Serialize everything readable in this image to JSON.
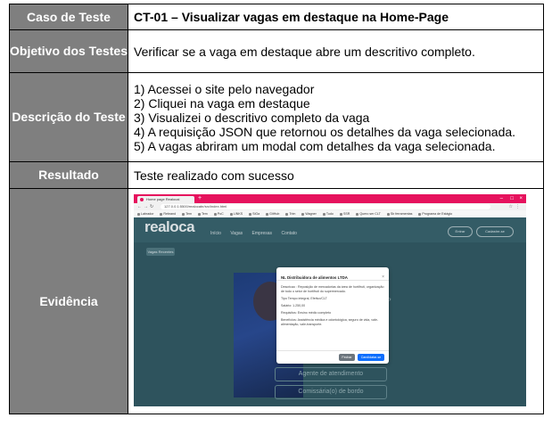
{
  "rows": {
    "caso": {
      "label": "Caso de Teste",
      "value": "CT-01 – Visualizar vagas em destaque na Home-Page"
    },
    "objetivo": {
      "label": "Objetivo dos Testes",
      "value": "Verificar se a vaga em destaque abre um descritivo completo."
    },
    "descricao": {
      "label": "Descrição do Teste",
      "steps": [
        "1) Acessei o site pelo navegador",
        "2) Cliquei na vaga em destaque",
        "3) Visualizei o descritivo completo da vaga",
        "4) A requisição JSON que retornou os detalhes da vaga selecionada.",
        "5) A vagas abriram um modal com detalhes da vaga selecionada."
      ]
    },
    "resultado": {
      "label": "Resultado",
      "value": "Teste realizado com sucesso"
    },
    "evidencia": {
      "label": "Evidência"
    }
  },
  "screenshot": {
    "browser": {
      "tab_title": "Home page Realocai",
      "url": "127.0.0.1:5500/realocabr/src/index.html",
      "bookmarks": [
        "Labrador",
        "Rebrand",
        "Tem",
        "Tem",
        "PoC",
        "LINKS",
        "SiGa",
        "GitHub",
        "Trim",
        "Wagner",
        "Tudo",
        "SSR",
        "Quero ser CLT",
        "Sb ferramentas",
        "Programa de Estágio"
      ],
      "colors": {
        "tab_bar": "#e6125d",
        "page_bg": "#2e535d"
      }
    },
    "site": {
      "logo": "realoca",
      "nav": [
        "Início",
        "Vagas",
        "Empresas",
        "Contato"
      ],
      "login_label": "Entrar",
      "signup_label": "Cadastre-se",
      "sub_button": "Vagas Recentes",
      "cards": [
        "Agente de atendimento",
        "Comissária(o) de bordo"
      ]
    },
    "modal": {
      "title": "NL Distribuidora de alimentos LTDA",
      "description": "Descricao : Reposição de mercadorias da área de hortifruti, organização de todo o setor de hortifruti do supermercado.",
      "tipo": "Tipo Tempo integral, Efetivo/CLT",
      "salario": "Salário: 1.250,00",
      "requisitos": "Requisitos: Ensino médio completo",
      "beneficios": "Benefícios: Assistência médica e odontológica, seguro de vida, vale-alimentação, vale-transporte.",
      "close_label": "Fechar",
      "apply_label": "Candidatar-se"
    }
  }
}
